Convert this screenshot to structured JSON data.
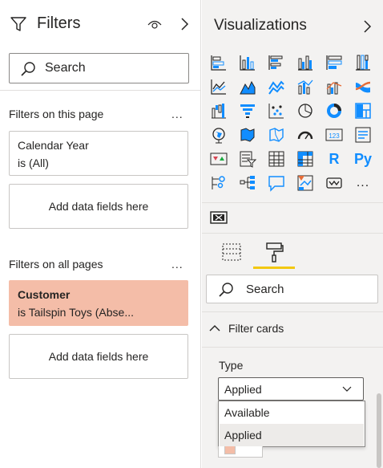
{
  "filters": {
    "title": "Filters",
    "search_placeholder": "Search",
    "page_section_label": "Filters on this page",
    "all_pages_section_label": "Filters on all pages",
    "more_label": "...",
    "page_cards": [
      {
        "field": "Calendar Year",
        "condition": "is (All)"
      }
    ],
    "all_pages_cards": [
      {
        "field": "Customer",
        "condition": "is Tailspin Toys (Abse..."
      }
    ],
    "add_data_label": "Add data fields here",
    "highlight_color": "#f4bda8"
  },
  "visualizations": {
    "title": "Visualizations",
    "icons": [
      "stacked-bar-icon",
      "stacked-column-icon",
      "clustered-bar-icon",
      "clustered-column-icon",
      "100-stacked-bar-icon",
      "100-stacked-column-icon",
      "line-chart-icon",
      "area-chart-icon",
      "stacked-area-icon",
      "line-column-icon",
      "line-clustered-column-icon",
      "ribbon-chart-icon",
      "waterfall-icon",
      "funnel-icon",
      "scatter-icon",
      "pie-chart-icon",
      "donut-chart-icon",
      "treemap-icon",
      "map-icon",
      "filled-map-icon",
      "shape-map-icon",
      "gauge-icon",
      "card-icon",
      "multi-row-card-icon",
      "kpi-icon",
      "slicer-icon",
      "table-icon",
      "matrix-icon",
      "r-visual-icon",
      "python-visual-icon",
      "key-influencers-icon",
      "decomposition-tree-icon",
      "qa-icon",
      "narrative-icon",
      "paginated-report-icon",
      "more-visuals-icon"
    ],
    "r_label": "R",
    "py_label": "Py",
    "card_label": "123",
    "more_label": "...",
    "search_placeholder": "Search",
    "section_title": "Filter cards",
    "type_label": "Type",
    "type_selected": "Applied",
    "type_options": [
      "Available",
      "Applied"
    ],
    "accent_color": "#f2c811",
    "icon_color": "#118dff"
  }
}
